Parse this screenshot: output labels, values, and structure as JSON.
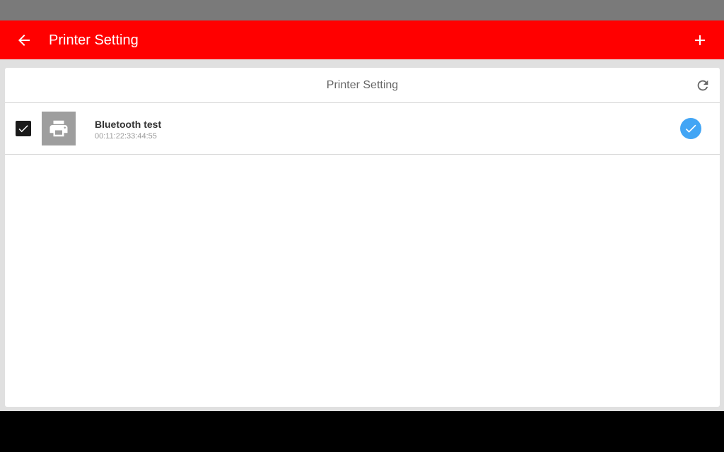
{
  "app_bar": {
    "title": "Printer Setting",
    "back_icon": "arrow-left-icon",
    "add_icon": "plus-icon",
    "color": "#ff0000"
  },
  "card": {
    "title": "Printer Setting",
    "refresh_icon": "refresh-icon"
  },
  "printers": [
    {
      "name": "Bluetooth test",
      "address": "00:11:22:33:44:55",
      "checked": true,
      "selected": true,
      "icon": "printer-icon"
    }
  ],
  "colors": {
    "status_bar": "#7a7a7a",
    "background": "#e0e0e0",
    "selected_check": "#42a5f5",
    "navigation_bar": "#000000"
  }
}
